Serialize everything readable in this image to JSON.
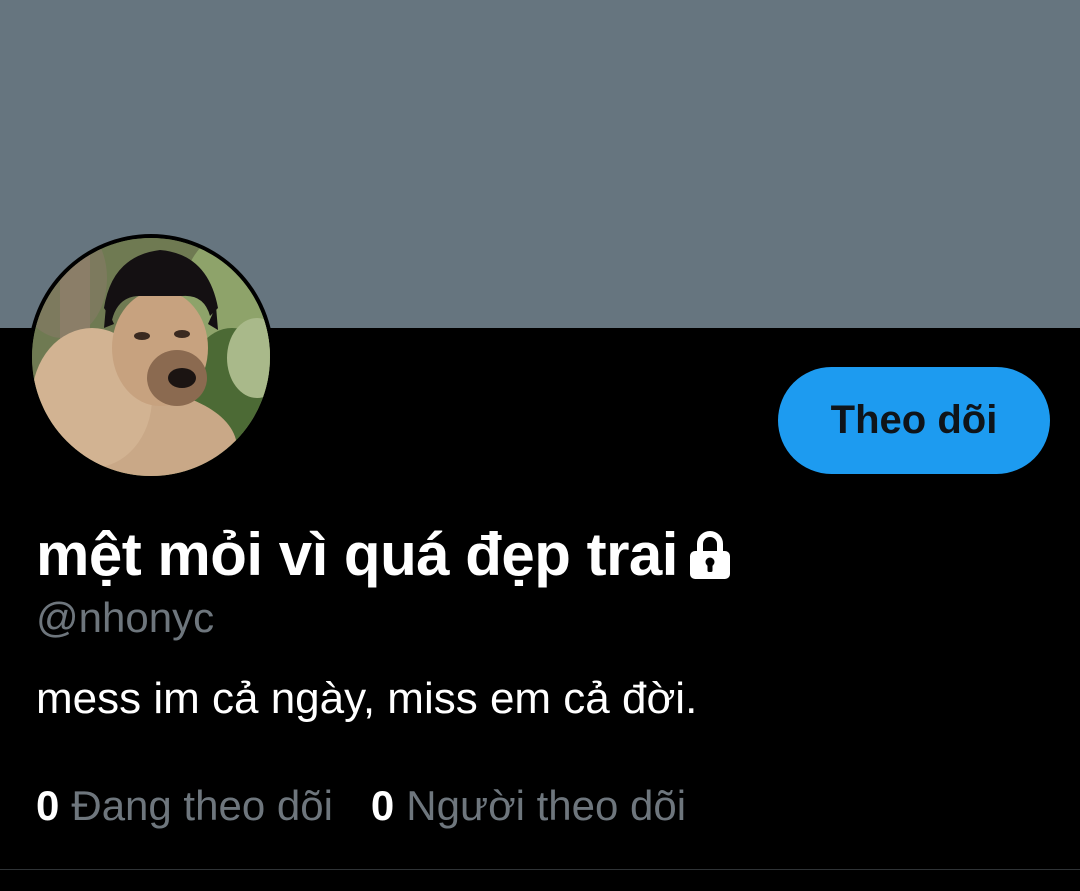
{
  "profile": {
    "display_name": "mệt mỏi vì quá đẹp trai",
    "protected_icon": "lock-icon",
    "handle": "@nhonyc",
    "bio": "mess im cả ngày, miss em cả đời.",
    "avatar": "dog-with-wig-photo"
  },
  "actions": {
    "follow_label": "Theo dõi"
  },
  "stats": {
    "following_count": "0",
    "following_label": "Đang theo dõi",
    "followers_count": "0",
    "followers_label": "Người theo dõi"
  },
  "colors": {
    "banner": "#66757f",
    "background": "#000000",
    "accent": "#1d9bf0",
    "secondary_text": "#6e767d"
  }
}
